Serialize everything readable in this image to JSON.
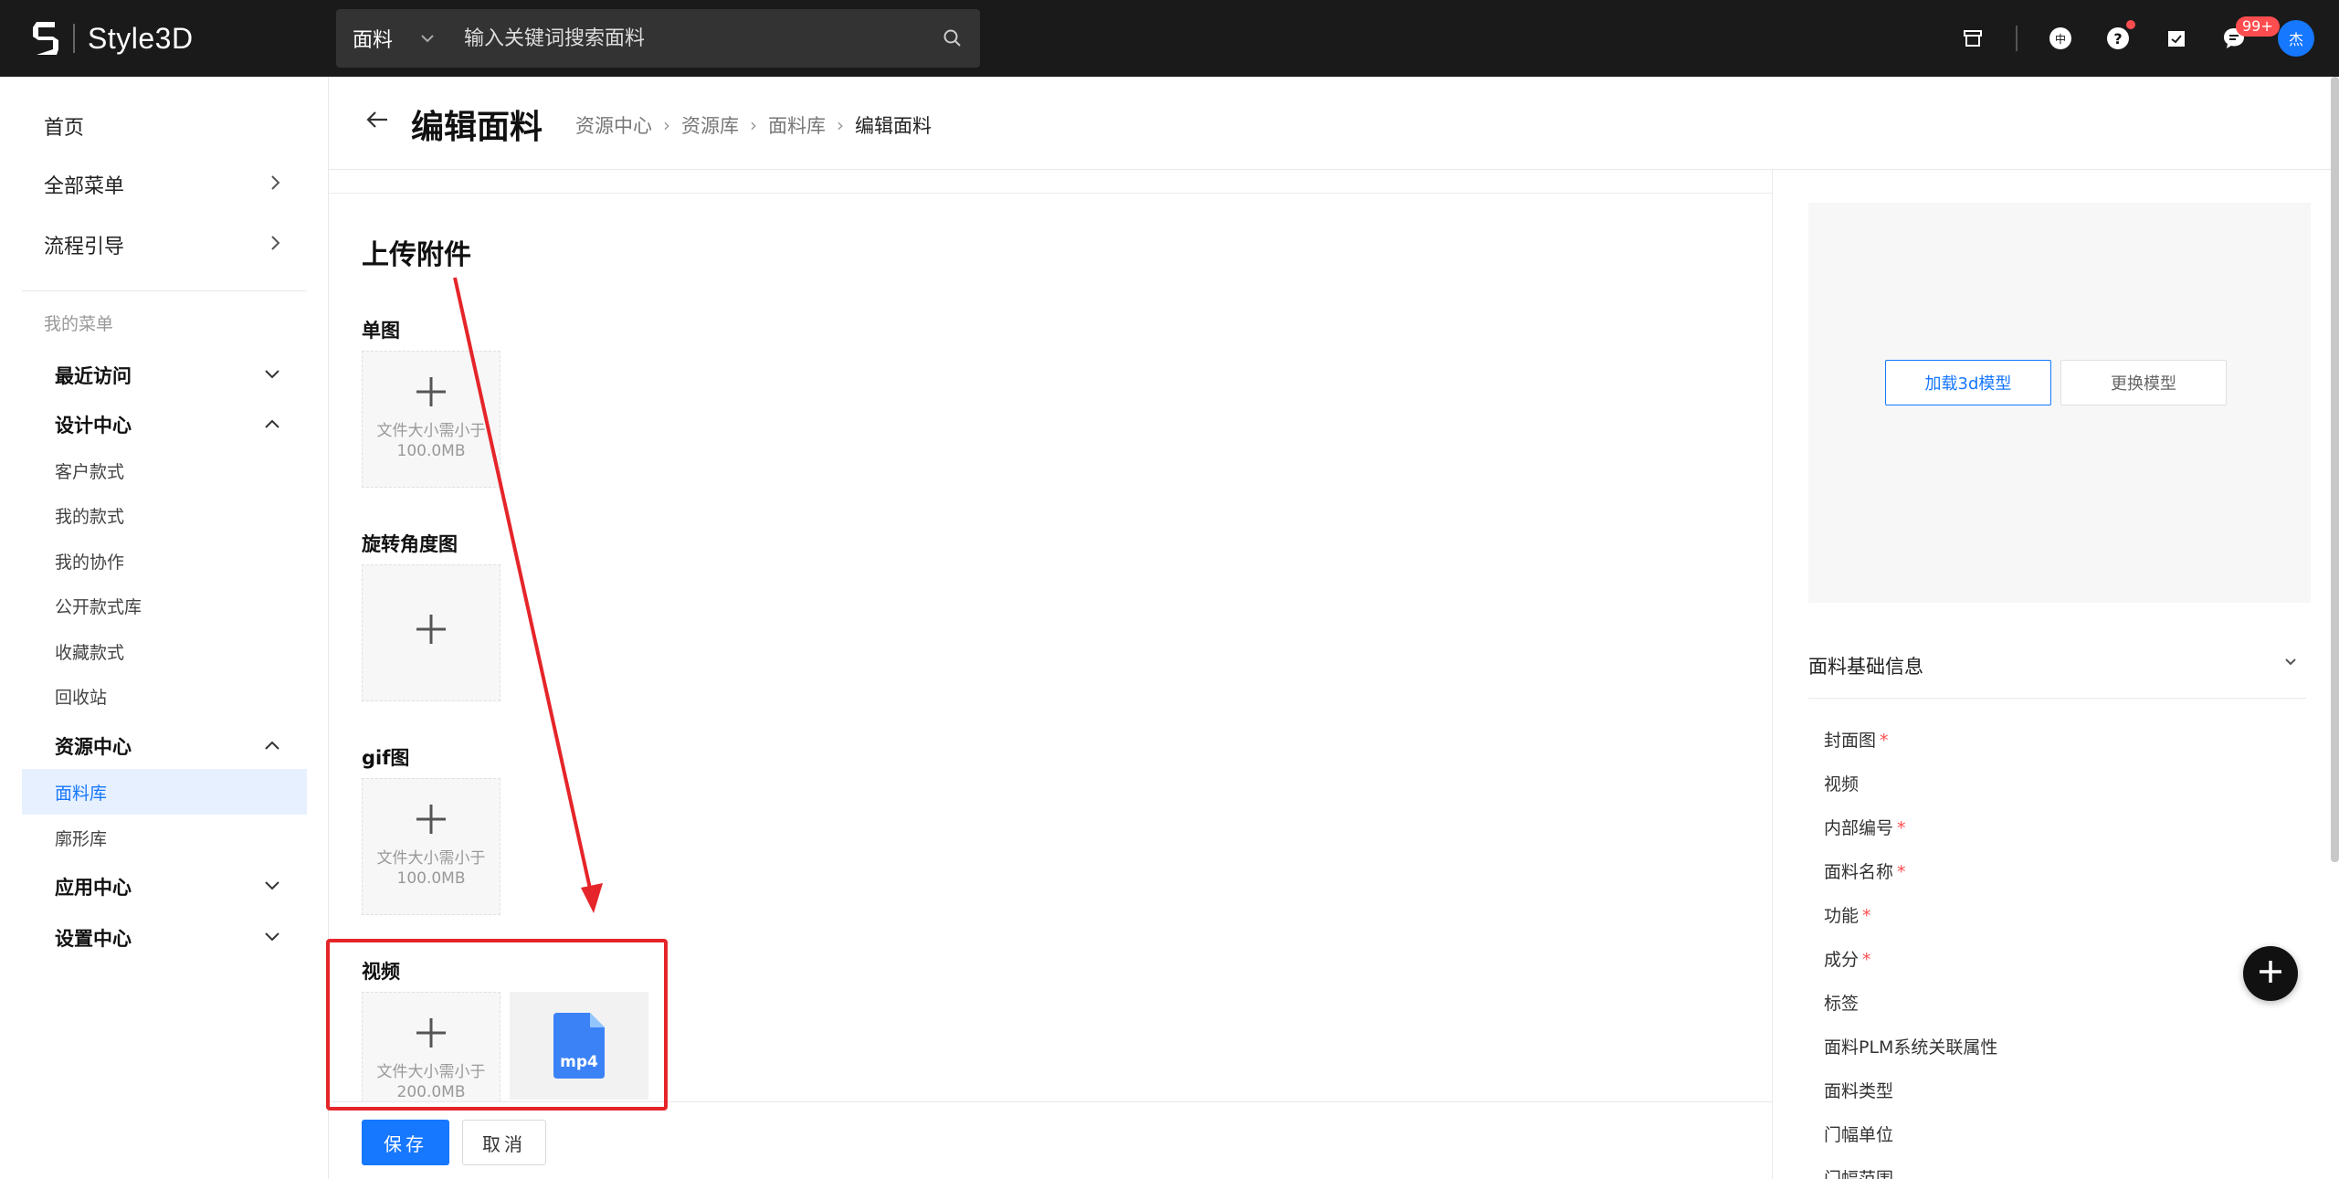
{
  "app": {
    "name": "Style3D"
  },
  "topbar": {
    "search_category": "面料",
    "search_placeholder": "输入关键词搜索面料",
    "notification_badge": "99+",
    "avatar_text": "杰",
    "lang_icon_text": "中",
    "help_icon_text": "?"
  },
  "sidebar": {
    "home": "首页",
    "all_menu": "全部菜单",
    "flow_guide": "流程引导",
    "my_menu": "我的菜单",
    "recent": "最近访问",
    "design_center": "设计中心",
    "design_items": [
      "客户款式",
      "我的款式",
      "我的协作",
      "公开款式库",
      "收藏款式",
      "回收站"
    ],
    "resource_center": "资源中心",
    "resource_items": [
      "面料库",
      "廓形库"
    ],
    "app_center": "应用中心",
    "settings_center": "设置中心"
  },
  "header": {
    "title": "编辑面料",
    "breadcrumb": [
      "资源中心",
      "资源库",
      "面料库",
      "编辑面料"
    ]
  },
  "upload": {
    "section_title": "上传附件",
    "single_image_label": "单图",
    "single_image_hint": "文件大小需小于\n100.0MB",
    "rotation_label": "旋转角度图",
    "gif_label": "gif图",
    "gif_hint": "文件大小需小于\n100.0MB",
    "video_label": "视频",
    "video_hint": "文件大小需小于\n200.0MB",
    "video_file_type": "mp4"
  },
  "footer": {
    "save_label": "保存",
    "cancel_label": "取消"
  },
  "right_panel": {
    "load_model_label": "加载3d模型",
    "replace_model_label": "更换模型",
    "info_title": "面料基础信息",
    "fields": [
      {
        "label": "封面图",
        "required": true
      },
      {
        "label": "视频",
        "required": false
      },
      {
        "label": "内部编号",
        "required": true
      },
      {
        "label": "面料名称",
        "required": true
      },
      {
        "label": "功能",
        "required": true
      },
      {
        "label": "成分",
        "required": true
      },
      {
        "label": "标签",
        "required": false
      },
      {
        "label": "面料PLM系统关联属性",
        "required": false
      },
      {
        "label": "面料类型",
        "required": false
      },
      {
        "label": "门幅单位",
        "required": false
      },
      {
        "label": "门幅范围",
        "required": false
      }
    ]
  },
  "colors": {
    "accent": "#1677ff",
    "topbar_bg": "#1a1a1a",
    "highlight": "#e5252a",
    "required": "#ff4d4f"
  }
}
